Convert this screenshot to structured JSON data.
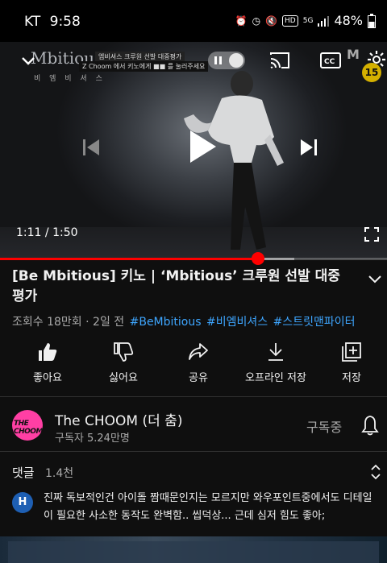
{
  "status_bar": {
    "carrier": "KT",
    "time": "9:58",
    "battery": "48%"
  },
  "player": {
    "logo_text": "Mbitious",
    "logo_sub": "비 엠 비 셔 스",
    "caption_top": "엠비셔스 크루원 선발 대중평가",
    "caption_bottom": "Z Choom 에서 키노에게 ■■ 를 눌러주세요",
    "current_time": "1:11",
    "duration": "1:50",
    "progress_fraction": 0.667,
    "buffer_fraction": 0.76
  },
  "video": {
    "title": "[Be Mbitious] 키노 | ‘Mbitious’ 크루원 선발 대중 평가",
    "views": "조회수 18만회",
    "age": "2일 전",
    "hashtags": [
      "#BeMbitious",
      "#비엠비셔스",
      "#스트릿맨파이터"
    ]
  },
  "actions": [
    {
      "label": "좋아요",
      "icon": "thumbs-up-icon"
    },
    {
      "label": "싫어요",
      "icon": "thumbs-down-icon"
    },
    {
      "label": "공유",
      "icon": "share-icon"
    },
    {
      "label": "오프라인 저장",
      "icon": "download-icon"
    },
    {
      "label": "저장",
      "icon": "save-playlist-icon"
    }
  ],
  "channel": {
    "name": "The CHOOM (더 춤)",
    "subscribers": "구독자 5.24만명",
    "avatar_text": "THE CHOOM",
    "subscribe_label": "구독중"
  },
  "comments": {
    "title": "댓글",
    "count": "1.4천",
    "top_comment": {
      "avatar_letter": "H",
      "text": "진짜 독보적인건 아이돌 짬때문인지는 모르지만 와우포인트중에서도 디테일이 필요한 사소한 동작도 완벽함.. 씹덕상... 근데 심저 힘도 좋아;"
    }
  },
  "colors": {
    "accent": "#ff0000",
    "link": "#3ea6ff",
    "background": "#0f0f0f",
    "avatar_pink": "#ff3fa4",
    "comment_avatar": "#1e5fb3"
  }
}
